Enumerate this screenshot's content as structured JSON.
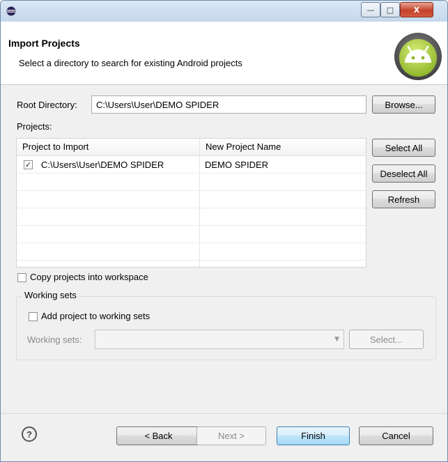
{
  "window": {
    "minimize_glyph": "—",
    "maximize_glyph": "□",
    "close_glyph": "X"
  },
  "header": {
    "title": "Import Projects",
    "description": "Select a directory to search for existing Android projects"
  },
  "root_directory": {
    "label": "Root Directory:",
    "value": "C:\\Users\\User\\DEMO SPIDER",
    "browse_label": "Browse..."
  },
  "projects": {
    "label": "Projects:",
    "columns": [
      "Project to Import",
      "New Project Name"
    ],
    "rows": [
      {
        "checked": true,
        "path": "C:\\Users\\User\\DEMO SPIDER",
        "name": "DEMO SPIDER"
      }
    ],
    "select_all_label": "Select All",
    "deselect_all_label": "Deselect All",
    "refresh_label": "Refresh"
  },
  "options": {
    "copy_label": "Copy projects into workspace"
  },
  "working_sets": {
    "group_title": "Working sets",
    "add_label": "Add project to working sets",
    "field_label": "Working sets:",
    "select_label": "Select..."
  },
  "footer": {
    "back_label": "< Back",
    "next_label": "Next >",
    "finish_label": "Finish",
    "cancel_label": "Cancel"
  },
  "colors": {
    "android_green": "#a4c639",
    "default_button_border": "#3c7fb1"
  }
}
